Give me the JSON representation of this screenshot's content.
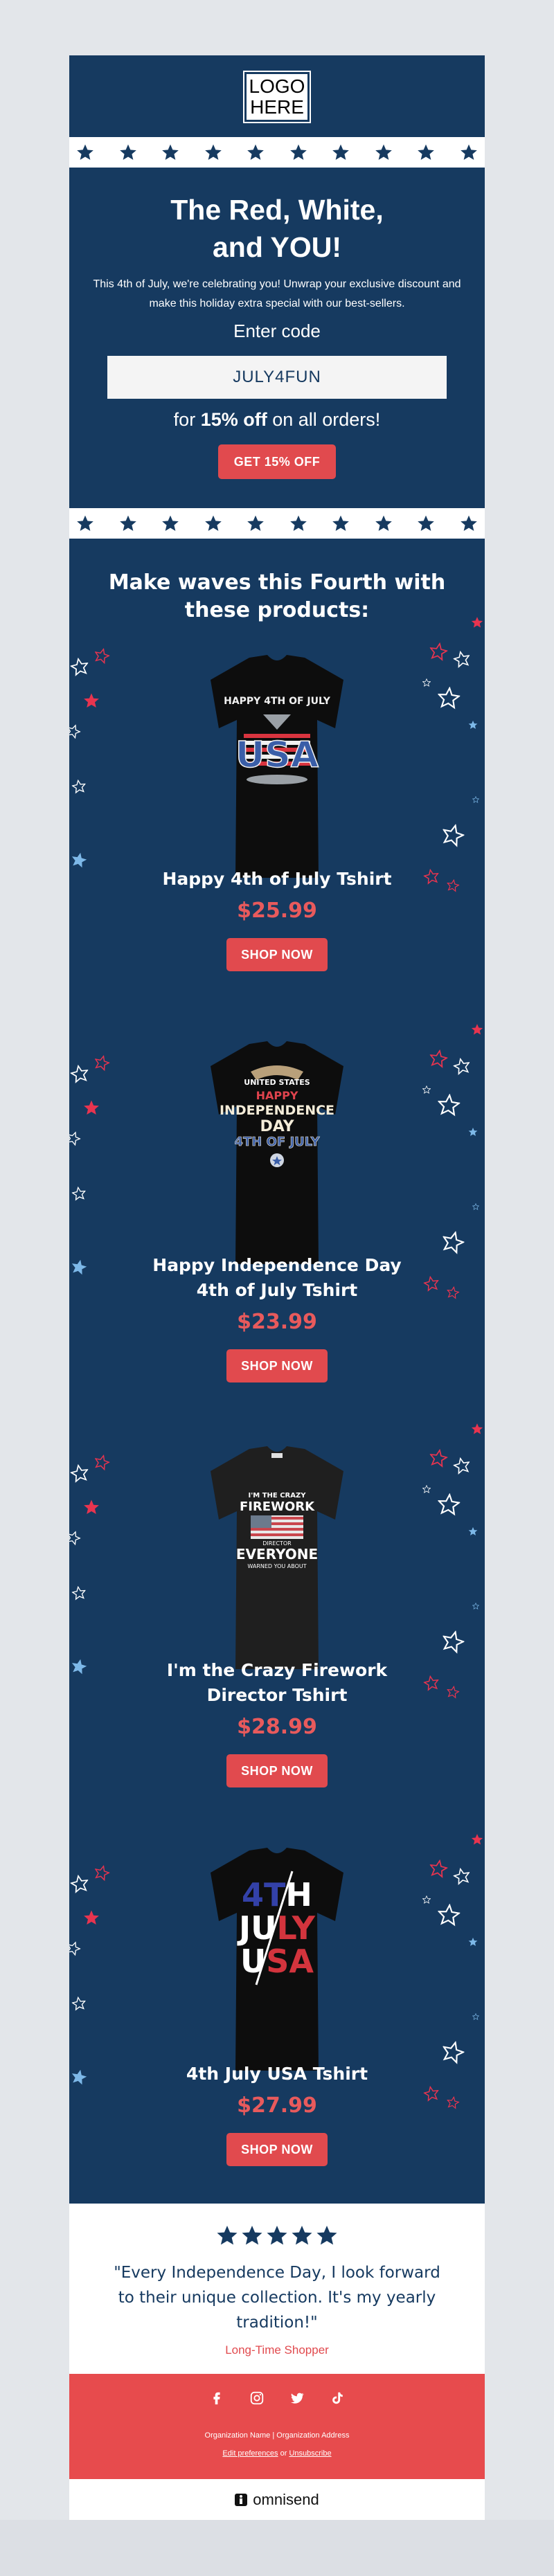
{
  "logo": {
    "text": "LOGO\nHERE"
  },
  "hero": {
    "title_line1": "The Red, White,",
    "title_line2": "and YOU!",
    "body": "This 4th of July, we're celebrating you! Unwrap your exclusive discount and make this holiday extra special with our best-sellers.",
    "code_label": "Enter code",
    "code": "JULY4FUN",
    "offer_prefix": "for ",
    "offer_bold": "15% off",
    "offer_suffix": " on all orders!",
    "cta": "GET 15% OFF"
  },
  "products_section": {
    "title_line1": "Make waves this Fourth with",
    "title_line2": "these products:",
    "items": [
      {
        "name_line1": "Happy 4th of July Tshirt",
        "name_line2": "",
        "price": "$25.99",
        "cta": "SHOP NOW",
        "shirt_text": [
          "HAPPY 4TH OF JULY",
          "USA"
        ]
      },
      {
        "name_line1": "Happy Independence Day",
        "name_line2": "4th of July Tshirt",
        "price": "$23.99",
        "cta": "SHOP NOW",
        "shirt_text": [
          "UNITED STATES",
          "HAPPY",
          "INDEPENDENCE",
          "DAY",
          "4TH OF JULY"
        ]
      },
      {
        "name_line1": "I'm the Crazy Firework",
        "name_line2": "Director Tshirt",
        "price": "$28.99",
        "cta": "SHOP NOW",
        "shirt_text": [
          "I'M THE CRAZY",
          "FIREWORK",
          "DIRECTOR",
          "EVERYONE",
          "WARNED YOU ABOUT"
        ]
      },
      {
        "name_line1": "4th July USA Tshirt",
        "name_line2": "",
        "price": "$27.99",
        "cta": "SHOP NOW",
        "shirt_text": [
          "4TH",
          "JULY",
          "USA"
        ]
      }
    ]
  },
  "review": {
    "stars": 5,
    "quote_line1": "\"Every Independence Day, I look forward",
    "quote_line2": "to their unique collection. It's my yearly",
    "quote_line3": "tradition!\"",
    "author": "Long-Time Shopper"
  },
  "footer": {
    "social": [
      "facebook-icon",
      "instagram-icon",
      "twitter-icon",
      "tiktok-icon"
    ],
    "address": "Organization Name | Organization Address",
    "edit_preferences": "Edit preferences",
    "or": " or ",
    "unsubscribe": "Unsubscribe"
  },
  "brand": {
    "name": "omnisend"
  },
  "colors": {
    "navy": "#163a60",
    "red": "#e14a4e",
    "pink_star": "#e8344f",
    "light_blue_star": "#7db8e8",
    "white": "#ffffff"
  }
}
